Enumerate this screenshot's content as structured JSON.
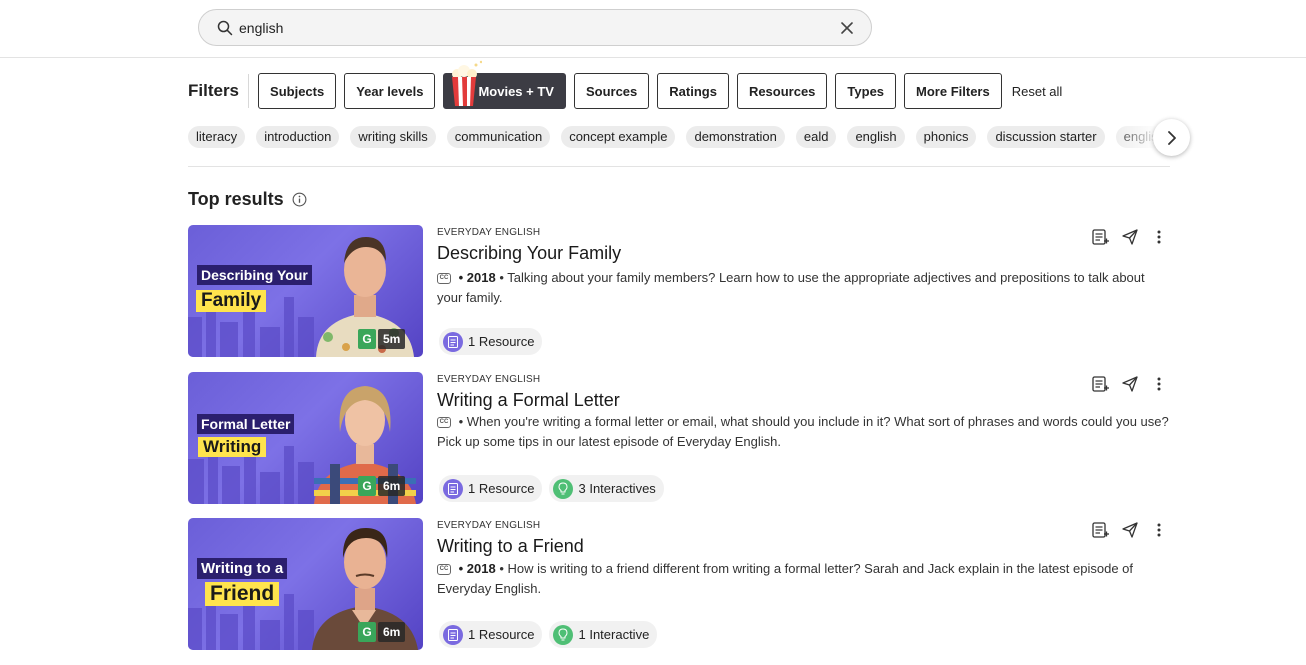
{
  "search": {
    "value": "english",
    "placeholder": ""
  },
  "filters": {
    "label": "Filters",
    "buttons": [
      "Subjects",
      "Year levels",
      "Movies + TV",
      "Sources",
      "Ratings",
      "Resources",
      "Types",
      "More Filters"
    ],
    "reset": "Reset all"
  },
  "tags": [
    "literacy",
    "introduction",
    "writing skills",
    "communication",
    "concept example",
    "demonstration",
    "eald",
    "english",
    "phonics",
    "discussion starter",
    "english"
  ],
  "section": {
    "title": "Top results"
  },
  "results": [
    {
      "source": "EVERYDAY ENGLISH",
      "title": "Describing Your Family",
      "year": "2018",
      "description": "Talking about your family members? Learn how to use the appropriate adjectives and prepositions to talk about your family.",
      "thumb_line1": "Describing Your",
      "thumb_line2": "Family",
      "badge": "G",
      "duration": "5m",
      "resources": "1 Resource",
      "interactives": ""
    },
    {
      "source": "EVERYDAY ENGLISH",
      "title": "Writing a Formal Letter",
      "year": "",
      "description": "When you're writing a formal letter or email, what should you include in it? What sort of phrases and words could you use? Pick up some tips in our latest episode of Everyday English.",
      "thumb_line1": "Formal Letter",
      "thumb_line2": "Writing",
      "badge": "G",
      "duration": "6m",
      "resources": "1 Resource",
      "interactives": "3 Interactives"
    },
    {
      "source": "EVERYDAY ENGLISH",
      "title": "Writing to a Friend",
      "year": "2018",
      "description": "How is writing to a friend different from writing a formal letter? Sarah and Jack explain in the latest episode of Everyday English.",
      "thumb_line1": "Writing to a",
      "thumb_line2": "Friend",
      "badge": "G",
      "duration": "6m",
      "resources": "1 Resource",
      "interactives": "1 Interactive"
    }
  ],
  "colors": {
    "accent_purple": "#6b5fd8",
    "badge_green": "#3aa65a",
    "dark_button": "#3c3c44",
    "thumb_yellow": "#ffe44d"
  },
  "icons": [
    "search-icon",
    "close-icon",
    "popcorn-icon",
    "chevron-right-icon",
    "info-icon",
    "add-to-playlist-icon",
    "share-icon",
    "more-vertical-icon",
    "document-icon",
    "lightbulb-icon"
  ]
}
